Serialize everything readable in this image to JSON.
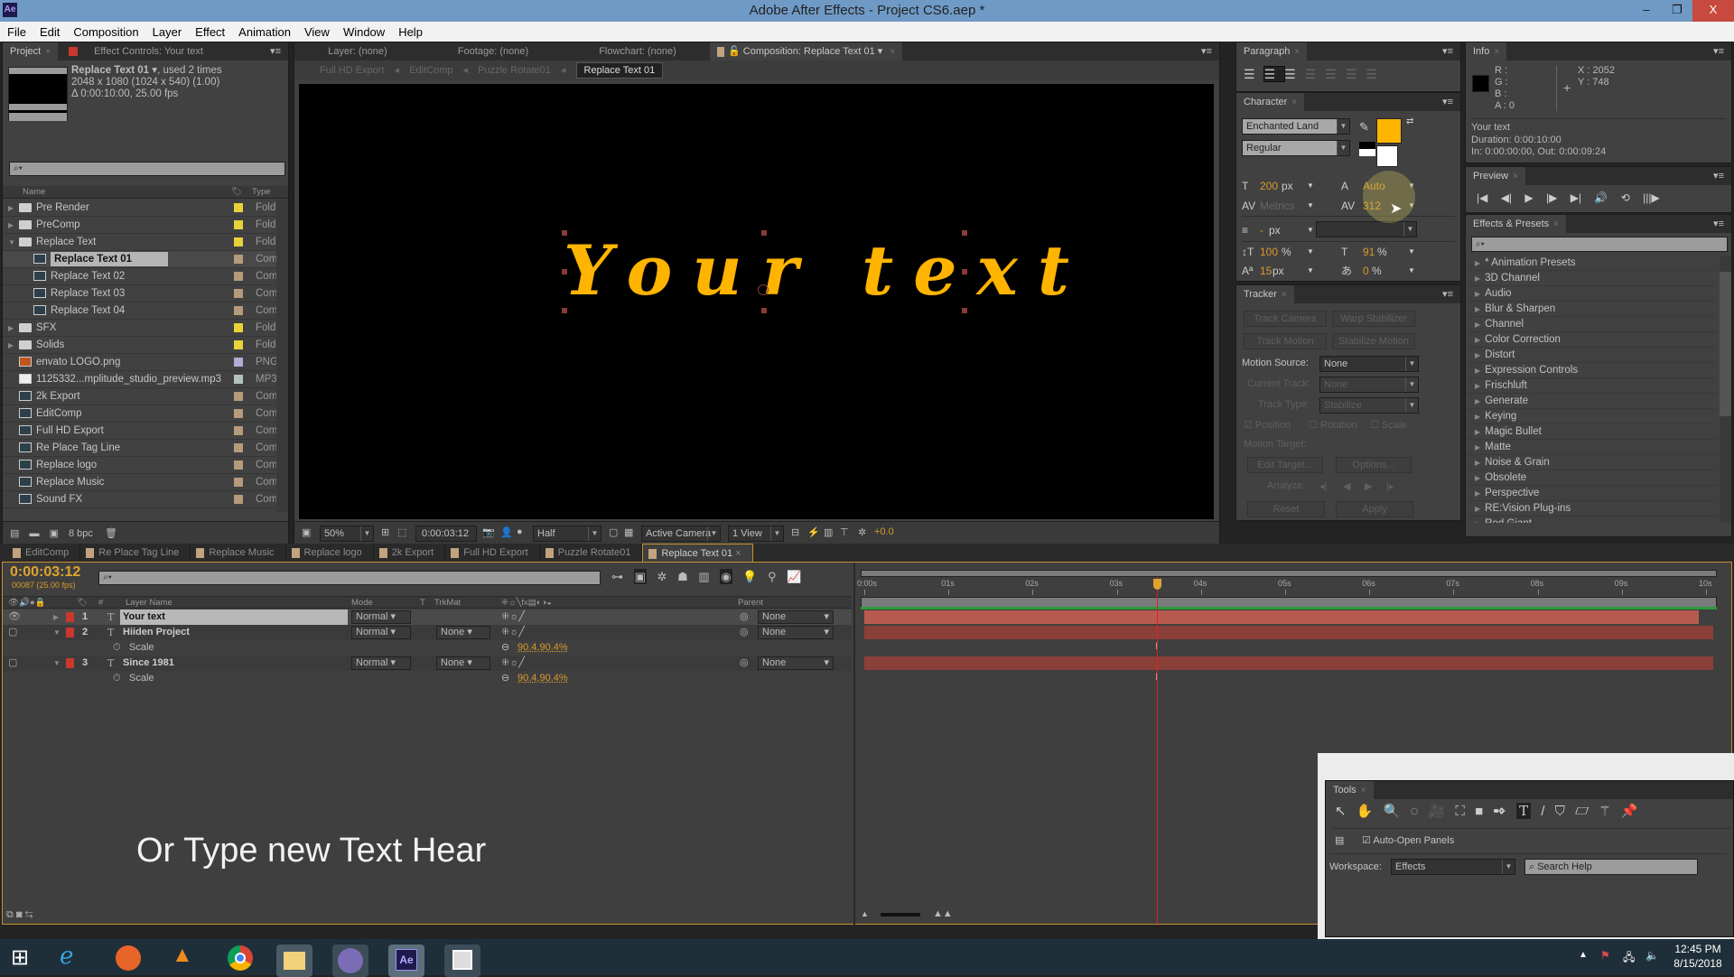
{
  "window": {
    "title": "Adobe After Effects - Project CS6.aep *",
    "app_logo": "Ae",
    "minimize": "–",
    "maximize": "❐",
    "close": "X"
  },
  "menu": [
    "File",
    "Edit",
    "Composition",
    "Layer",
    "Effect",
    "Animation",
    "View",
    "Window",
    "Help"
  ],
  "project_panel": {
    "tab_project": "Project",
    "tab_effect_controls": "Effect Controls: Your text",
    "selected_name": "Replace Text 01",
    "selected_usage": ", used 2 times",
    "selected_dims": "2048 x 1080  (1024 x 540) (1.00)",
    "selected_duration": "Δ 0:00:10:00, 25.00 fps",
    "search_placeholder": "",
    "col_name": "Name",
    "col_type": "Type",
    "items": [
      {
        "name": "Pre Render",
        "type": "Fold",
        "kind": "folder",
        "indent": 0,
        "expanded": false,
        "color": "#e8d23a"
      },
      {
        "name": "PreComp",
        "type": "Fold",
        "kind": "folder",
        "indent": 0,
        "expanded": false,
        "color": "#e8d23a"
      },
      {
        "name": "Replace Text",
        "type": "Fold",
        "kind": "folder",
        "indent": 0,
        "expanded": true,
        "color": "#e8d23a"
      },
      {
        "name": "Replace Text 01",
        "type": "Com",
        "kind": "comp",
        "indent": 1,
        "selected": true,
        "color": "#b59b7b"
      },
      {
        "name": "Replace Text 02",
        "type": "Com",
        "kind": "comp",
        "indent": 1,
        "color": "#b59b7b"
      },
      {
        "name": "Replace Text 03",
        "type": "Com",
        "kind": "comp",
        "indent": 1,
        "color": "#b59b7b"
      },
      {
        "name": "Replace Text 04",
        "type": "Com",
        "kind": "comp",
        "indent": 1,
        "color": "#b59b7b"
      },
      {
        "name": "SFX",
        "type": "Fold",
        "kind": "folder",
        "indent": 0,
        "expanded": false,
        "color": "#e8d23a"
      },
      {
        "name": "Solids",
        "type": "Fold",
        "kind": "folder",
        "indent": 0,
        "expanded": false,
        "color": "#e8d23a"
      },
      {
        "name": "envato LOGO.png",
        "type": "PNG",
        "kind": "image",
        "indent": 0,
        "color": "#b3abd4"
      },
      {
        "name": "1125332...mplitude_studio_preview.mp3",
        "type": "MP3",
        "kind": "audio",
        "indent": 0,
        "color": "#b3c1c1"
      },
      {
        "name": "2k Export",
        "type": "Com",
        "kind": "comp",
        "indent": 0,
        "color": "#b59b7b"
      },
      {
        "name": "EditComp",
        "type": "Com",
        "kind": "comp",
        "indent": 0,
        "color": "#b59b7b"
      },
      {
        "name": "Full HD Export",
        "type": "Com",
        "kind": "comp",
        "indent": 0,
        "color": "#b59b7b"
      },
      {
        "name": "Re Place Tag Line",
        "type": "Com",
        "kind": "comp",
        "indent": 0,
        "color": "#b59b7b"
      },
      {
        "name": "Replace logo",
        "type": "Com",
        "kind": "comp",
        "indent": 0,
        "color": "#b59b7b"
      },
      {
        "name": "Replace Music",
        "type": "Com",
        "kind": "comp",
        "indent": 0,
        "color": "#b59b7b"
      },
      {
        "name": "Sound FX",
        "type": "Com",
        "kind": "comp",
        "indent": 0,
        "color": "#b59b7b"
      }
    ],
    "bpc": "8 bpc"
  },
  "viewer": {
    "tabs": [
      "Layer: (none)",
      "Footage: (none)",
      "Flowchart: (none)"
    ],
    "comp_tab": "Composition: Replace Text 01",
    "breadcrumbs": [
      "Full HD Export",
      "EditComp",
      "Puzzle Rotate01",
      "Replace Text 01"
    ],
    "canvas_text": "Your text",
    "text_color": "#ffb400",
    "zoom": "50%",
    "timecode": "0:00:03:12",
    "resolution": "Half",
    "camera": "Active Camera",
    "views": "1 View",
    "exposure": "+0.0"
  },
  "paragraph": {
    "title": "Paragraph"
  },
  "character": {
    "title": "Character",
    "font": "Enchanted Land",
    "style": "Regular",
    "fill_color": "#ffb400",
    "size": "200",
    "size_unit": "px",
    "leading": "Auto",
    "kerning": "Metrics",
    "tracking": "312",
    "stroke_width": "-",
    "stroke_unit": "px",
    "vscale": "100",
    "hscale": "91",
    "baseline": "15",
    "tsume": "0",
    "pct": "%"
  },
  "tracker": {
    "title": "Tracker",
    "track_camera": "Track Camera",
    "warp_stabilizer": "Warp Stabilizer",
    "track_motion": "Track Motion",
    "stabilize_motion": "Stabilize Motion",
    "motion_source_label": "Motion Source:",
    "motion_source": "None",
    "current_track_label": "Current Track:",
    "current_track": "None",
    "track_type_label": "Track Type:",
    "track_type": "Stabilize",
    "position": "Position",
    "rotation": "Rotation",
    "scale": "Scale",
    "motion_target": "Motion Target:",
    "edit_target": "Edit Target...",
    "options": "Options...",
    "analyze": "Analyze:",
    "reset": "Reset",
    "apply": "Apply"
  },
  "info": {
    "title": "Info",
    "r": "R :",
    "g": "G :",
    "b": "B :",
    "a": "A : 0",
    "x": "X : 2052",
    "y": "Y : 748",
    "layer": "Your text",
    "duration": "Duration: 0:00:10:00",
    "inout": "In: 0:00:00:00, Out: 0:00:09:24"
  },
  "preview": {
    "title": "Preview"
  },
  "effects": {
    "title": "Effects & Presets",
    "items": [
      "* Animation Presets",
      "3D Channel",
      "Audio",
      "Blur & Sharpen",
      "Channel",
      "Color Correction",
      "Distort",
      "Expression Controls",
      "Frischluft",
      "Generate",
      "Keying",
      "Magic Bullet",
      "Matte",
      "Noise & Grain",
      "Obsolete",
      "Perspective",
      "RE:Vision Plug-ins",
      "Red Giant"
    ]
  },
  "timeline": {
    "tabs": [
      "EditComp",
      "Re Place Tag Line",
      "Replace Music",
      "Replace logo",
      "2k Export",
      "Full HD Export",
      "Puzzle Rotate01",
      "Replace Text 01"
    ],
    "current_time": "0:00:03:12",
    "frame_info": "00087 (25.00 fps)",
    "col_layer_name": "Layer Name",
    "col_mode": "Mode",
    "col_t": "T",
    "col_trkmat": "TrkMat",
    "col_parent": "Parent",
    "ruler": [
      "0:00s",
      "01s",
      "02s",
      "03s",
      "04s",
      "05s",
      "06s",
      "07s",
      "08s",
      "09s",
      "10s"
    ],
    "playhead_seconds": 3.48,
    "duration_seconds": 10,
    "layers": [
      {
        "num": "1",
        "name": "Your text",
        "mode": "Normal",
        "trkmat": "",
        "parent": "None",
        "selected": true
      },
      {
        "num": "2",
        "name": "Hiiden Project",
        "mode": "Normal",
        "trkmat": "None",
        "parent": "None",
        "prop": "Scale",
        "value": "90.4,90.4%"
      },
      {
        "num": "3",
        "name": "Since 1981",
        "mode": "Normal",
        "trkmat": "None",
        "parent": "None",
        "prop": "Scale",
        "value": "90.4,90.4%"
      }
    ]
  },
  "overlay_caption": "Or Type new Text Hear",
  "tools": {
    "title": "Tools",
    "auto_open": "Auto-Open Panels",
    "workspace_label": "Workspace:",
    "workspace": "Effects",
    "search_help": "Search Help"
  },
  "taskbar": {
    "time": "12:45 PM",
    "date": "8/15/2018"
  }
}
